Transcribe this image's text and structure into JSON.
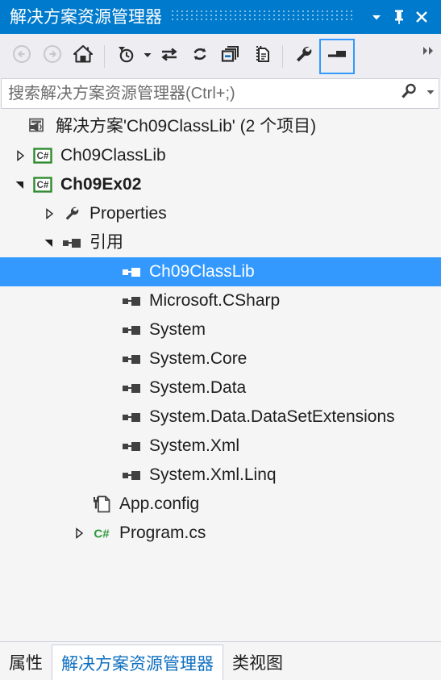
{
  "window": {
    "title": "解决方案资源管理器",
    "controls": [
      {
        "name": "window-menu-dropdown",
        "icon": "chevron-down-icon"
      },
      {
        "name": "pin-window",
        "icon": "pin-icon"
      },
      {
        "name": "close-window",
        "icon": "close-icon"
      }
    ]
  },
  "toolbar": {
    "buttons": [
      {
        "name": "back",
        "icon": "back-arrow-icon",
        "label": "后退",
        "enabled": false
      },
      {
        "name": "forward",
        "icon": "forward-arrow-icon",
        "label": "前进",
        "enabled": false
      },
      {
        "name": "home",
        "icon": "home-icon",
        "label": "主页",
        "enabled": true
      },
      {
        "name": "pending-changes",
        "icon": "clock-filter-icon",
        "label": "挂起的更改筛选器",
        "enabled": true,
        "has_dropdown": true
      },
      {
        "name": "sync-with-active-document",
        "icon": "sync-arrows-icon",
        "label": "与活动文档同步",
        "enabled": true
      },
      {
        "name": "refresh",
        "icon": "refresh-icon",
        "label": "刷新",
        "enabled": true
      },
      {
        "name": "collapse-all",
        "icon": "collapse-all-icon",
        "label": "全部折叠",
        "enabled": true
      },
      {
        "name": "show-all-files",
        "icon": "show-all-files-icon",
        "label": "显示所有文件",
        "enabled": true
      },
      {
        "name": "properties",
        "icon": "wrench-icon",
        "label": "属性",
        "enabled": true
      },
      {
        "name": "preview-selected-items",
        "icon": "preview-icon",
        "label": "预览选定项",
        "enabled": true,
        "selected": true
      }
    ],
    "overflow_icon": "double-chevron-right-icon"
  },
  "search": {
    "placeholder": "搜索解决方案资源管理器(Ctrl+;)",
    "value": "",
    "icon": "search-magnifier-icon",
    "dropdown_icon": "chevron-down-icon"
  },
  "tree": {
    "rows": [
      {
        "label": "解决方案'Ch09ClassLib' (2 个项目)",
        "icon": "solution-icon",
        "indent": 0,
        "expander": "none",
        "bold": false,
        "selected": false
      },
      {
        "label": "Ch09ClassLib",
        "icon": "csharp-project-icon",
        "indent": 1,
        "expander": "collapsed",
        "bold": false,
        "selected": false
      },
      {
        "label": "Ch09Ex02",
        "icon": "csharp-project-icon",
        "indent": 1,
        "expander": "expanded",
        "bold": true,
        "selected": false
      },
      {
        "label": "Properties",
        "icon": "wrench-icon",
        "indent": 2,
        "expander": "collapsed",
        "bold": false,
        "selected": false
      },
      {
        "label": "引用",
        "icon": "reference-icon",
        "indent": 2,
        "expander": "expanded",
        "bold": false,
        "selected": false
      },
      {
        "label": "Ch09ClassLib",
        "icon": "reference-icon",
        "indent": 4,
        "expander": "none",
        "bold": false,
        "selected": true
      },
      {
        "label": "Microsoft.CSharp",
        "icon": "reference-icon",
        "indent": 4,
        "expander": "none",
        "bold": false,
        "selected": false
      },
      {
        "label": "System",
        "icon": "reference-icon",
        "indent": 4,
        "expander": "none",
        "bold": false,
        "selected": false
      },
      {
        "label": "System.Core",
        "icon": "reference-icon",
        "indent": 4,
        "expander": "none",
        "bold": false,
        "selected": false
      },
      {
        "label": "System.Data",
        "icon": "reference-icon",
        "indent": 4,
        "expander": "none",
        "bold": false,
        "selected": false
      },
      {
        "label": "System.Data.DataSetExtensions",
        "icon": "reference-icon",
        "indent": 4,
        "expander": "none",
        "bold": false,
        "selected": false
      },
      {
        "label": "System.Xml",
        "icon": "reference-icon",
        "indent": 4,
        "expander": "none",
        "bold": false,
        "selected": false
      },
      {
        "label": "System.Xml.Linq",
        "icon": "reference-icon",
        "indent": 4,
        "expander": "none",
        "bold": false,
        "selected": false
      },
      {
        "label": "App.config",
        "icon": "config-file-icon",
        "indent": 3,
        "expander": "none",
        "bold": false,
        "selected": false
      },
      {
        "label": "Program.cs",
        "icon": "csharp-file-icon",
        "indent": 3,
        "expander": "collapsed",
        "bold": false,
        "selected": false
      }
    ]
  },
  "bottom_tabs": [
    {
      "label": "属性",
      "active": false
    },
    {
      "label": "解决方案资源管理器",
      "active": true
    },
    {
      "label": "类视图",
      "active": false
    }
  ],
  "colors": {
    "title_bar": "#007acc",
    "toolbar": "#eeeef2",
    "tree_background": "#f5f5f5",
    "selection": "#3399ff",
    "active_tab_text": "#0e70c0",
    "border": "#cccedb",
    "text": "#1e1e1e"
  }
}
